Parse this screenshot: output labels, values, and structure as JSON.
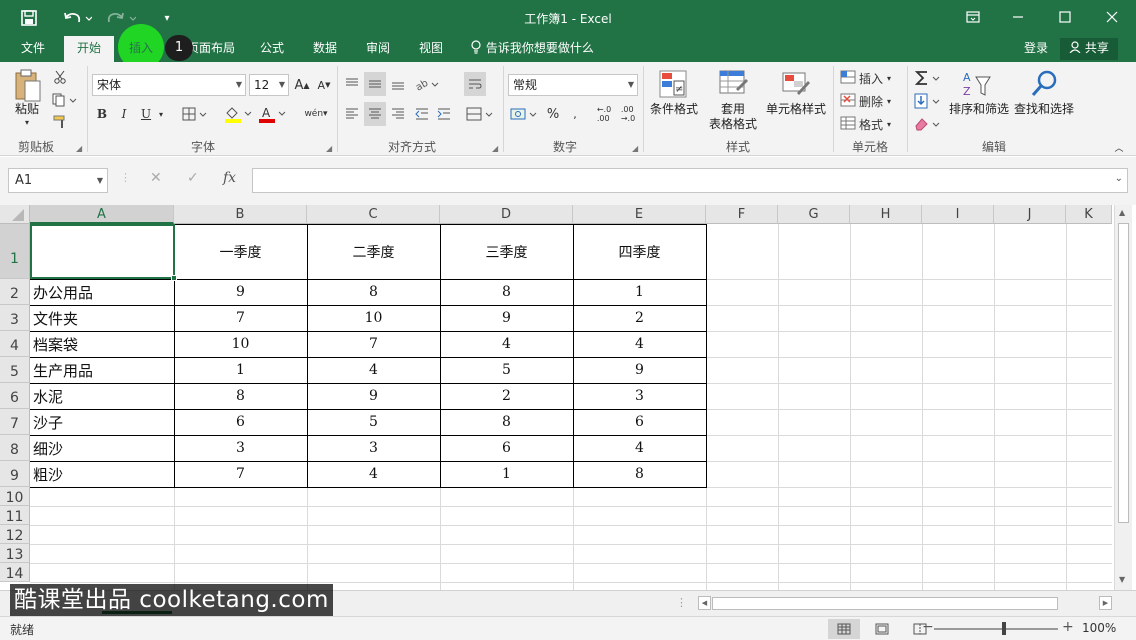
{
  "window": {
    "title": "工作簿1 - Excel",
    "accent": "#217346"
  },
  "ribbon_tabs": [
    "文件",
    "开始",
    "插入",
    "页面布局",
    "公式",
    "数据",
    "审阅",
    "视图"
  ],
  "tell_me": "告诉我你想要做什么",
  "account": {
    "login": "登录",
    "share": "共享"
  },
  "cursor_step": "1",
  "clipboard": {
    "paste": "粘贴",
    "group": "剪贴板"
  },
  "font": {
    "name": "宋体",
    "size": "12",
    "bold": "B",
    "italic": "I",
    "underline": "U",
    "group": "字体"
  },
  "alignment": {
    "group": "对齐方式"
  },
  "number": {
    "format": "常规",
    "percent": "%",
    "group": "数字"
  },
  "styles": {
    "conditional": "条件格式",
    "table_format_1": "套用",
    "table_format_2": "表格格式",
    "cell_styles": "单元格样式",
    "group": "样式"
  },
  "cells": {
    "insert": "插入",
    "delete": "删除",
    "format": "格式",
    "group": "单元格"
  },
  "editing": {
    "sort_filter": "排序和筛选",
    "find_select": "查找和选择",
    "group": "编辑"
  },
  "formula_bar": {
    "name_box": "A1",
    "cancel": "✕",
    "enter": "✓",
    "fx": "fx",
    "value": ""
  },
  "sheet": {
    "columns": [
      "A",
      "B",
      "C",
      "D",
      "E",
      "F",
      "G",
      "H",
      "I",
      "J",
      "K"
    ],
    "rows": [
      "1",
      "2",
      "3",
      "4",
      "5",
      "6",
      "7",
      "8",
      "9",
      "10",
      "11",
      "12",
      "13",
      "14"
    ],
    "selected_cell": "A1",
    "header_row": [
      "",
      "一季度",
      "二季度",
      "三季度",
      "四季度"
    ],
    "data": [
      [
        "办公用品",
        "9",
        "8",
        "8",
        "1"
      ],
      [
        "文件夹",
        "7",
        "10",
        "9",
        "2"
      ],
      [
        "档案袋",
        "10",
        "7",
        "4",
        "4"
      ],
      [
        "生产用品",
        "1",
        "4",
        "5",
        "9"
      ],
      [
        "水泥",
        "8",
        "9",
        "2",
        "3"
      ],
      [
        "沙子",
        "6",
        "5",
        "8",
        "6"
      ],
      [
        "细沙",
        "3",
        "3",
        "6",
        "4"
      ],
      [
        "粗沙",
        "7",
        "4",
        "1",
        "8"
      ]
    ]
  },
  "status": {
    "ready": "就绪",
    "zoom": "100%"
  },
  "watermark": "酷课堂出品 coolketang.com"
}
